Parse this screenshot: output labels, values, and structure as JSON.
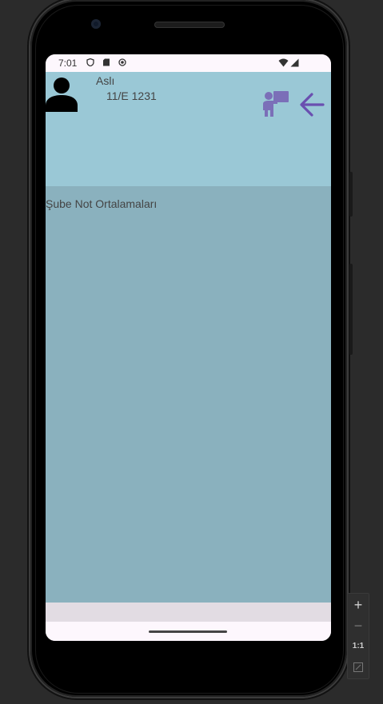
{
  "status_bar": {
    "time": "7:01",
    "icons": [
      "shield-icon",
      "sd-card-icon",
      "sync-icon",
      "wifi-icon",
      "signal-icon"
    ]
  },
  "header": {
    "user_name": "Aslı",
    "class_info": "11/E 1231",
    "icons": [
      "person-icon",
      "teacher-board-icon",
      "arrow-back-icon"
    ],
    "accent_color": "#6a4fb0",
    "background_color": "#9ac8d6"
  },
  "content": {
    "section_title": "Şube Not Ortalamaları",
    "background_color": "#8ab1be"
  },
  "emulator_zoom": {
    "plus_label": "+",
    "minus_label": "−",
    "ratio_label": "1:1"
  }
}
